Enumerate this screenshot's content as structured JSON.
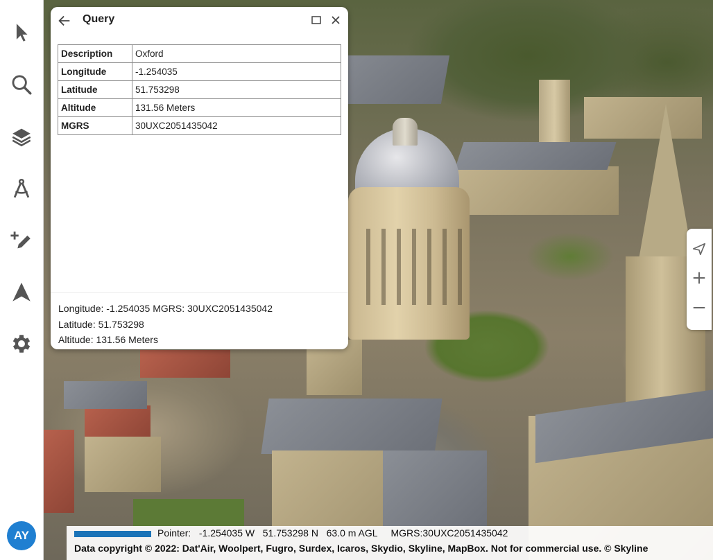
{
  "app": {
    "user_initials": "AY",
    "accent_color": "#1f7fd1"
  },
  "sidebar": {
    "items": [
      {
        "name": "select",
        "icon": "cursor-arrow-icon"
      },
      {
        "name": "search",
        "icon": "search-icon"
      },
      {
        "name": "layers",
        "icon": "layers-icon"
      },
      {
        "name": "measure",
        "icon": "compass-icon"
      },
      {
        "name": "draw",
        "icon": "add-pencil-icon"
      },
      {
        "name": "navigate",
        "icon": "navigation-arrow-icon"
      },
      {
        "name": "settings",
        "icon": "gear-icon"
      }
    ]
  },
  "query_panel": {
    "title": "Query",
    "rows": [
      {
        "key": "Description",
        "value": "Oxford"
      },
      {
        "key": "Longitude",
        "value": "-1.254035"
      },
      {
        "key": "Latitude",
        "value": "51.753298"
      },
      {
        "key": "Altitude",
        "value": "131.56 Meters"
      },
      {
        "key": "MGRS",
        "value": "30UXC2051435042"
      }
    ],
    "summary": {
      "line1": "Longitude: -1.254035 MGRS: 30UXC2051435042",
      "line2": "Latitude: 51.753298",
      "line3": "Altitude: 131.56 Meters"
    }
  },
  "status_bar": {
    "pointer_label": "Pointer:",
    "longitude": "-1.254035 W",
    "latitude": "51.753298 N",
    "altitude": "63.0 m AGL",
    "mgrs": "MGRS:30UXC2051435042",
    "copyright": "Data copyright © 2022: Dat'Air, Woolpert, Fugro, Surdex, Icaros, Skydio, Skyline, MapBox. Not for commercial use. © Skyline"
  },
  "nav_controls": {
    "icons": [
      "north-arrow-icon",
      "zoom-in-icon",
      "zoom-out-icon"
    ]
  }
}
